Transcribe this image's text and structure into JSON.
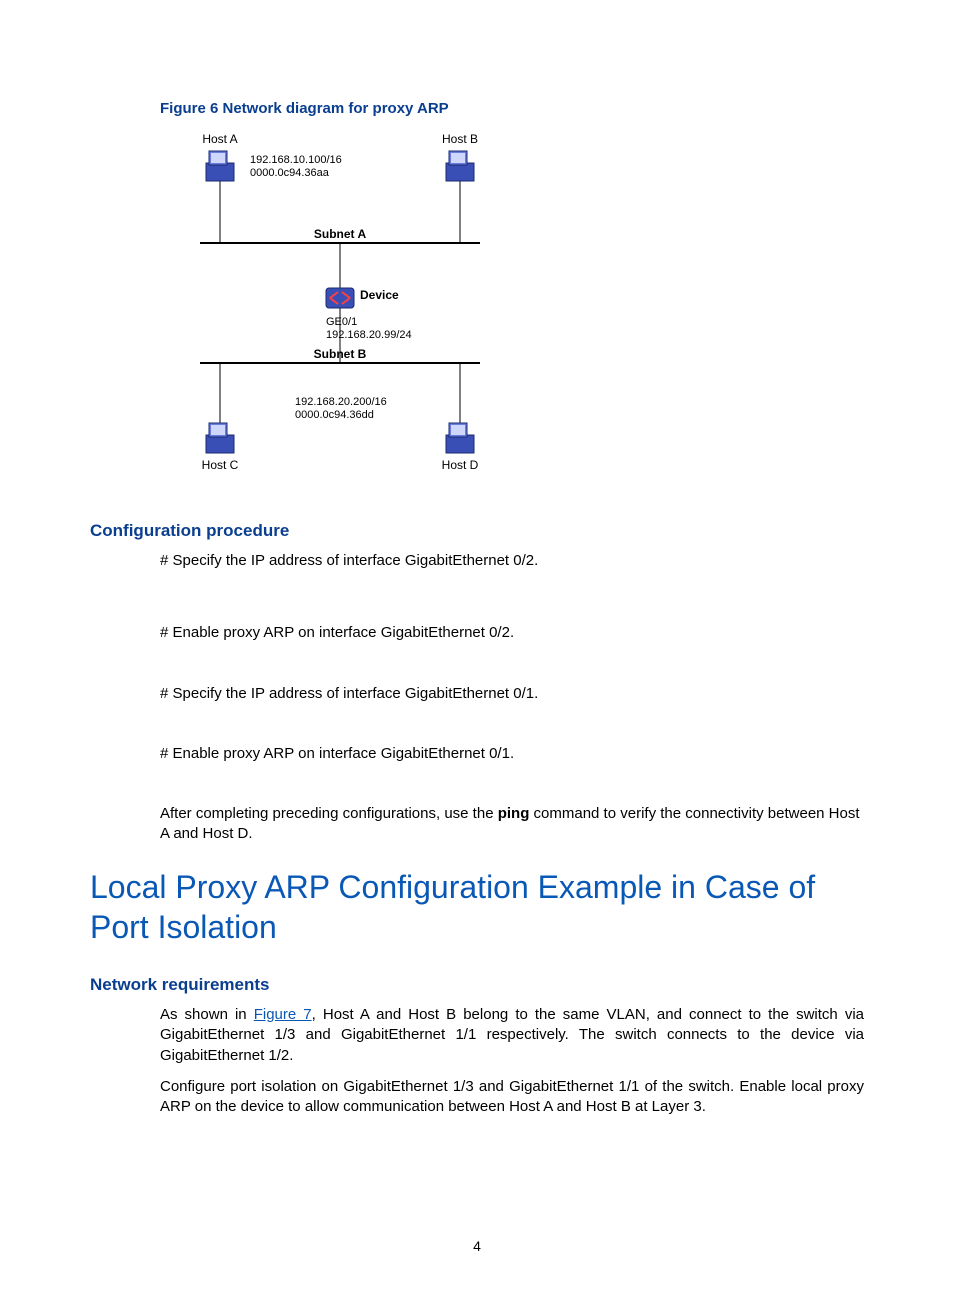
{
  "figure": {
    "caption": "Figure 6 Network diagram for proxy ARP",
    "hostA": "Host A",
    "hostA_ip": "192.168.10.100/16",
    "hostA_mac": "0000.0c94.36aa",
    "hostB": "Host B",
    "subnetA": "Subnet A",
    "device": "Device",
    "device_if": "GE0/1",
    "device_ip": "192.168.20.99/24",
    "subnetB": "Subnet B",
    "hostC": "Host C",
    "hostD": "Host D",
    "hostD_ip": "192.168.20.200/16",
    "hostD_mac": "0000.0c94.36dd"
  },
  "conf": {
    "heading": "Configuration procedure",
    "step1": "# Specify the IP address of interface GigabitEthernet 0/2.",
    "step2": "# Enable proxy ARP on interface GigabitEthernet 0/2.",
    "step3": "# Specify the IP address of interface GigabitEthernet 0/1.",
    "step4": "# Enable proxy ARP on interface GigabitEthernet 0/1.",
    "final_pre": "After completing preceding configurations, use the ",
    "final_cmd": "ping",
    "final_post": " command to verify the connectivity between Host A and Host D."
  },
  "section": {
    "title": "Local Proxy ARP Configuration Example in Case of Port Isolation",
    "subheading": "Network requirements",
    "p1_pre": "As shown in ",
    "p1_link": "Figure 7",
    "p1_post": ", Host A and Host B belong to the same VLAN, and connect to the switch via GigabitEthernet 1/3 and GigabitEthernet 1/1 respectively. The switch connects to the device via GigabitEthernet 1/2.",
    "p2": "Configure port isolation on GigabitEthernet 1/3 and GigabitEthernet 1/1 of the switch. Enable local proxy ARP on the device to allow communication between Host A and Host B at Layer 3."
  },
  "page": "4"
}
